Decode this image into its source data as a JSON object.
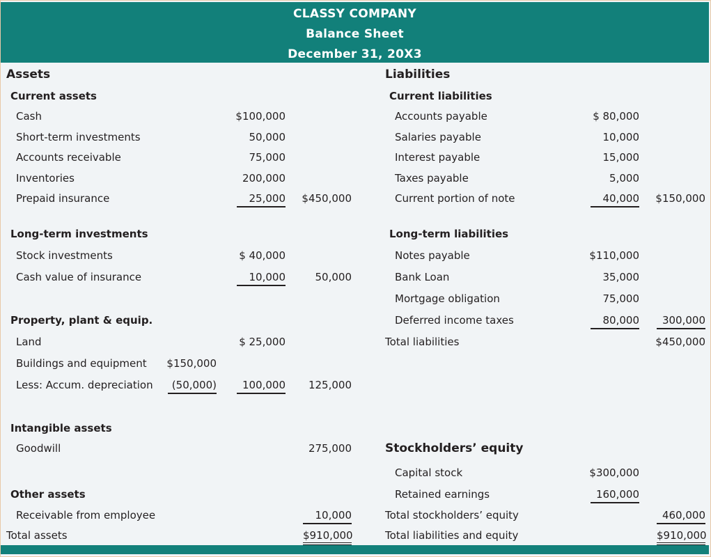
{
  "header": {
    "company": "CLASSY COMPANY",
    "statement": "Balance Sheet",
    "date": "December 31, 20X3"
  },
  "assets": {
    "title": "Assets",
    "current": {
      "title": "Current assets",
      "items": [
        {
          "label": "Cash",
          "amount": "$100,000"
        },
        {
          "label": "Short-term investments",
          "amount": "50,000"
        },
        {
          "label": "Accounts receivable",
          "amount": "75,000"
        },
        {
          "label": "Inventories",
          "amount": "200,000"
        },
        {
          "label": "Prepaid insurance",
          "amount": "25,000"
        }
      ],
      "total": "$450,000"
    },
    "long_term_investments": {
      "title": "Long-term investments",
      "items": [
        {
          "label": "Stock investments",
          "amount": "$ 40,000"
        },
        {
          "label": "Cash value of insurance",
          "amount": "10,000"
        }
      ],
      "total": "50,000"
    },
    "ppe": {
      "title": "Property, plant & equip.",
      "land_label": "Land",
      "land_amount": "$ 25,000",
      "buildings_label": "Buildings and equipment",
      "buildings_amount": "$150,000",
      "depreciation_label": "Less:  Accum. depreciation",
      "depreciation_amount": "(50,000)",
      "net_buildings": "100,000",
      "total": "125,000"
    },
    "intangible": {
      "title": "Intangible assets",
      "goodwill_label": "Goodwill",
      "goodwill_amount": "275,000"
    },
    "other": {
      "title": "Other assets",
      "item_label": "Receivable from employee",
      "item_amount": "10,000"
    },
    "total_label": "Total assets",
    "total_amount": "$910,000"
  },
  "liabilities": {
    "title": "Liabilities",
    "current": {
      "title": "Current liabilities",
      "items": [
        {
          "label": "Accounts payable",
          "amount": "$ 80,000"
        },
        {
          "label": "Salaries payable",
          "amount": "10,000"
        },
        {
          "label": "Interest payable",
          "amount": "15,000"
        },
        {
          "label": "Taxes payable",
          "amount": "5,000"
        },
        {
          "label": "Current portion of note",
          "amount": "40,000"
        }
      ],
      "total": "$150,000"
    },
    "long_term": {
      "title": "Long-term liabilities",
      "items": [
        {
          "label": "Notes payable",
          "amount": "$110,000"
        },
        {
          "label": "Bank Loan",
          "amount": "35,000"
        },
        {
          "label": "Mortgage obligation",
          "amount": "75,000"
        },
        {
          "label": "Deferred income taxes",
          "amount": "80,000"
        }
      ],
      "total": "300,000"
    },
    "total_label": "Total liabilities",
    "total_amount": "$450,000"
  },
  "equity": {
    "title": "Stockholders’ equity",
    "items": [
      {
        "label": "Capital stock",
        "amount": "$300,000"
      },
      {
        "label": "Retained earnings",
        "amount": "160,000"
      }
    ],
    "total_label": "Total stockholders’ equity",
    "total_amount": "460,000",
    "grand_total_label": "Total liabilities and equity",
    "grand_total_amount": "$910,000"
  }
}
